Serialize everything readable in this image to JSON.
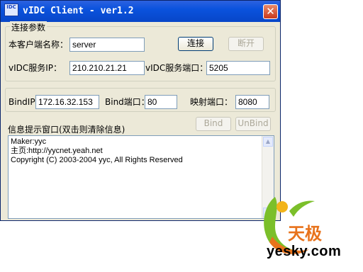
{
  "window": {
    "title": "vIDC Client - ver1.2",
    "icon_text": "IDC",
    "close_glyph": "✕"
  },
  "connect_group": {
    "legend": "连接参数",
    "client_name_label": "本客户端名称：",
    "client_name_value": "server",
    "connect_button": "连接",
    "disconnect_button": "断开",
    "server_ip_label": "vIDC服务IP：",
    "server_ip_value": "210.210.21.21",
    "server_port_label": "vIDC服务端口：",
    "server_port_value": "5205"
  },
  "bind_group": {
    "bind_ip_label": "BindIP：",
    "bind_ip_value": "172.16.32.153",
    "bind_port_label": "Bind端口：",
    "bind_port_value": "80",
    "map_port_label": "映射端口：",
    "map_port_value": "8080",
    "bind_button": "Bind",
    "unbind_button": "UnBind"
  },
  "log": {
    "label": "信息提示窗口(双击则清除信息)",
    "lines": [
      "Maker:yyc",
      "主页:http://yycnet.yeah.net",
      "Copyright (C) 2003-2004 yyc, All Rights Reserved"
    ]
  },
  "watermark": {
    "brand_cn": "天极",
    "url": "yesky.com"
  },
  "colors": {
    "titlebar": "#0a52dd",
    "dialog_bg": "#ece9d8",
    "close": "#c9391c",
    "brand_orange": "#e8731c",
    "brand_green": "#7bbf2a"
  }
}
